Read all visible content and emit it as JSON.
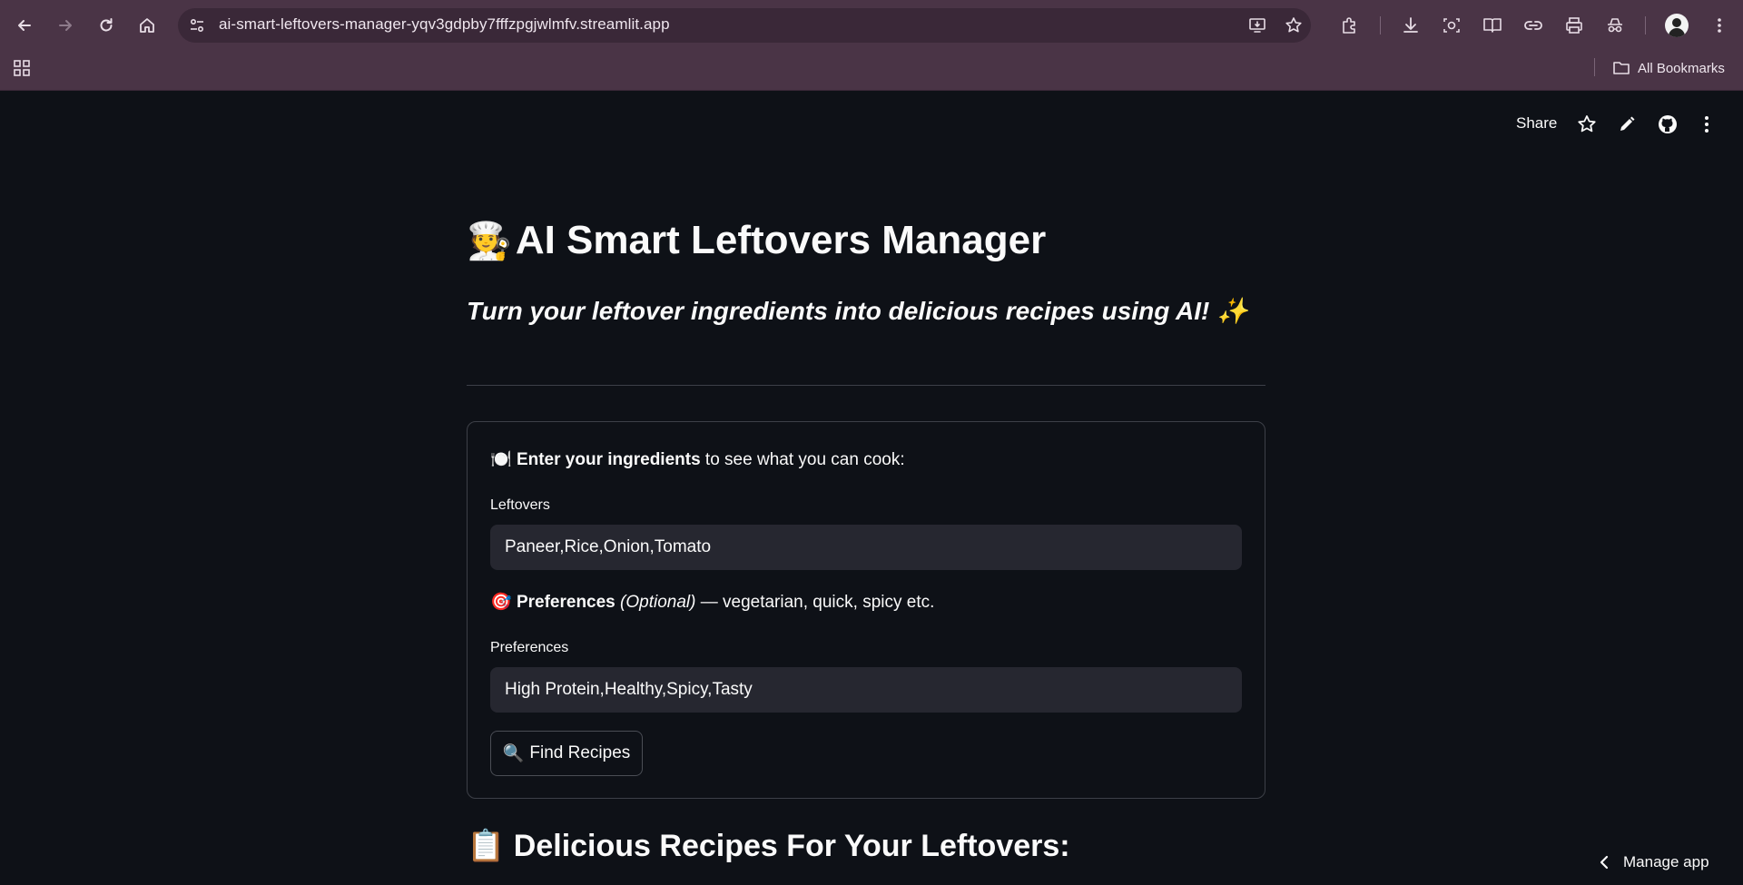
{
  "browser": {
    "url": "ai-smart-leftovers-manager-yqv3gdpby7fffzpgjwlmfv.streamlit.app",
    "bookmarks_folder": "All Bookmarks"
  },
  "header": {
    "share_label": "Share"
  },
  "main": {
    "title_emoji": "🧑‍🍳",
    "title": "AI Smart Leftovers Manager",
    "subtitle": "Turn your leftover ingredients into delicious recipes using AI! ✨",
    "ingredients_prompt": {
      "emoji": "🍽️",
      "bold": "Enter your ingredients",
      "rest": " to see what you can cook:"
    },
    "leftovers_label": "Leftovers",
    "leftovers_value": "Paneer,Rice,Onion,Tomato",
    "preferences_prompt": {
      "emoji": "🎯",
      "bold": "Preferences",
      "italic": "(Optional)",
      "rest": " — vegetarian, quick, spicy etc."
    },
    "preferences_label": "Preferences",
    "preferences_value": "High Protein,Healthy,Spicy,Tasty",
    "find_button_emoji": "🔍",
    "find_button_label": "Find Recipes",
    "results_title": "📋 Delicious Recipes For Your Leftovers:"
  },
  "footer": {
    "manage_app_label": "Manage app"
  },
  "colors": {
    "app_bg": "#0e1117",
    "chrome_bg": "#4a3446",
    "input_bg": "#262730",
    "text": "#fafafa"
  }
}
